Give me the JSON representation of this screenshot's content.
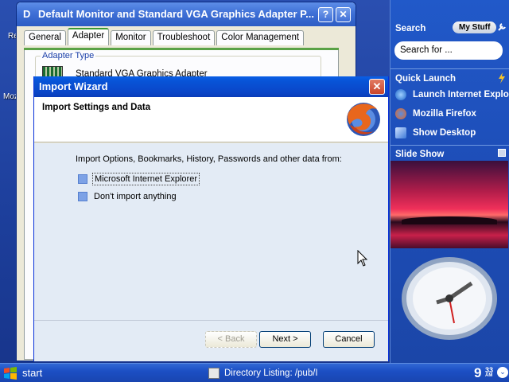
{
  "desktop": {
    "frag1": "Re",
    "frag2": "Moz"
  },
  "display_window": {
    "title_prefix": "D",
    "title": "Default Monitor and Standard VGA Graphics Adapter P...",
    "help": "?",
    "close": "✕",
    "tabs": [
      "General",
      "Adapter",
      "Monitor",
      "Troubleshoot",
      "Color Management"
    ],
    "active_tab": "Adapter",
    "adapter_group_label": "Adapter Type",
    "adapter_name": "Standard VGA Graphics Adapter"
  },
  "wizard": {
    "title": "Import Wizard",
    "close": "✕",
    "header_title": "Import Settings and Data",
    "prompt": "Import Options, Bookmarks, History, Passwords and other data from:",
    "options": [
      {
        "label": "Microsoft Internet Explorer",
        "selected": true
      },
      {
        "label": "Don't import anything",
        "selected": false
      }
    ],
    "back_label": "< Back",
    "next_label": "Next >",
    "cancel_label": "Cancel"
  },
  "sidebar": {
    "search_heading": "Search",
    "mystuff": "My Stuff",
    "search_placeholder": "Search for ...",
    "quick_launch_heading": "Quick Launch",
    "quick_launch_items": [
      "Launch Internet Explorer",
      "Mozilla Firefox",
      "Show Desktop"
    ],
    "slideshow_heading": "Slide Show"
  },
  "taskbar": {
    "start": "start",
    "task": "Directory Listing: /pub/I",
    "time_hour": "9",
    "time_min": "33",
    "time_ampm": "AM"
  },
  "colors": {
    "titlebar": "#0a4fd6",
    "sidebar": "#1e4fba",
    "wizard_body": "#e3ebf5",
    "active_tab_accent": "#3c9a32"
  }
}
